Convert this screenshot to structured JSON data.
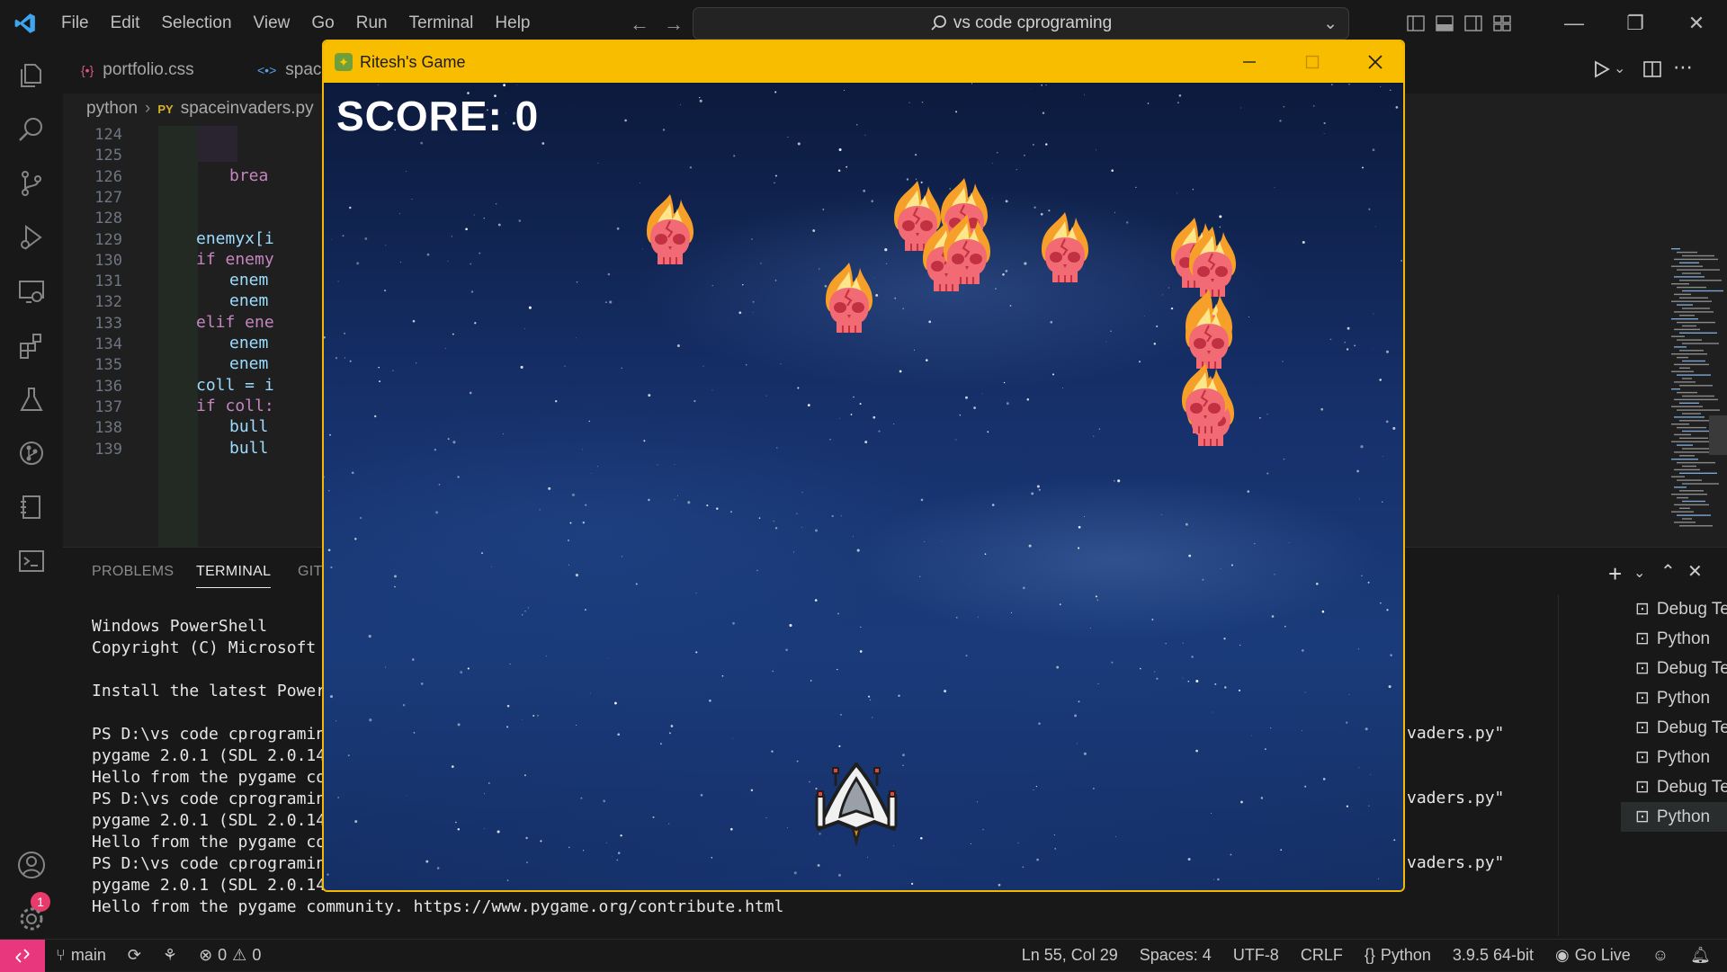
{
  "menu": [
    "File",
    "Edit",
    "Selection",
    "View",
    "Go",
    "Run",
    "Terminal",
    "Help"
  ],
  "command_center": "vs code cprograming",
  "tabs": [
    {
      "label": "portfolio.css",
      "icon": "css-file-icon"
    },
    {
      "label": "spac",
      "icon": "html-file-icon"
    }
  ],
  "breadcrumb": {
    "folder": "python",
    "file_badge": "PY",
    "file": "spaceinvaders.py"
  },
  "line_numbers": [
    "124",
    "125",
    "126",
    "127",
    "128",
    "129",
    "130",
    "131",
    "132",
    "133",
    "134",
    "135",
    "136",
    "137",
    "138",
    "139"
  ],
  "code_lines": [
    {
      "line": "126",
      "text": "brea"
    },
    {
      "line": "129",
      "text": "enemyx[i"
    },
    {
      "line": "130",
      "text": "if enemy"
    },
    {
      "line": "131",
      "text": "enem"
    },
    {
      "line": "132",
      "text": "enem"
    },
    {
      "line": "133",
      "text": "elif ene"
    },
    {
      "line": "134",
      "text": "enem"
    },
    {
      "line": "135",
      "text": "enem"
    },
    {
      "line": "136",
      "text": "coll = i"
    },
    {
      "line": "137",
      "text": "if coll:"
    },
    {
      "line": "138",
      "text": "bull"
    },
    {
      "line": "139",
      "text": "bull"
    }
  ],
  "panel": {
    "tabs": [
      "PROBLEMS",
      "TERMINAL",
      "GIT"
    ],
    "active_tab": "TERMINAL",
    "terminal_lines": [
      "Windows PowerShell",
      "Copyright (C) Microsoft",
      "",
      "Install the latest Power",
      "",
      "PS D:\\vs code cprogramin",
      "pygame 2.0.1 (SDL 2.0.14",
      "Hello from the pygame co",
      "PS D:\\vs code cprogramin",
      "pygame 2.0.1 (SDL 2.0.14",
      "Hello from the pygame co",
      "PS D:\\vs code cprogramin",
      "pygame 2.0.1 (SDL 2.0.14",
      "Hello from the pygame community. https://www.pygame.org/contribute.html"
    ],
    "right_fragments": [
      "vaders.py\"",
      "vaders.py\"",
      "vaders.py\""
    ],
    "terminal_list": [
      "Debug Termi...",
      "Python",
      "Debug Termi...",
      "Python",
      "Debug Termi...",
      "Python",
      "Debug Termi...",
      "Python"
    ]
  },
  "statusbar": {
    "branch": "main",
    "errors": "0",
    "warnings": "0",
    "position": "Ln 55, Col 29",
    "spaces": "Spaces: 4",
    "encoding": "UTF-8",
    "eol": "CRLF",
    "language": "Python",
    "interpreter": "3.9.5 64-bit",
    "go_live": "Go Live"
  },
  "account_badge": "1",
  "game": {
    "window_title": "Ritesh's Game",
    "score_label": "SCORE: 0",
    "enemy_icon": "flaming-skull-icon",
    "player_icon": "spaceship-icon"
  },
  "colors": {
    "accent_yellow": "#f9bd00",
    "remote_pink": "#e8377d",
    "keyword_pink": "#c586c0",
    "variable_blue": "#9cdcfe"
  }
}
